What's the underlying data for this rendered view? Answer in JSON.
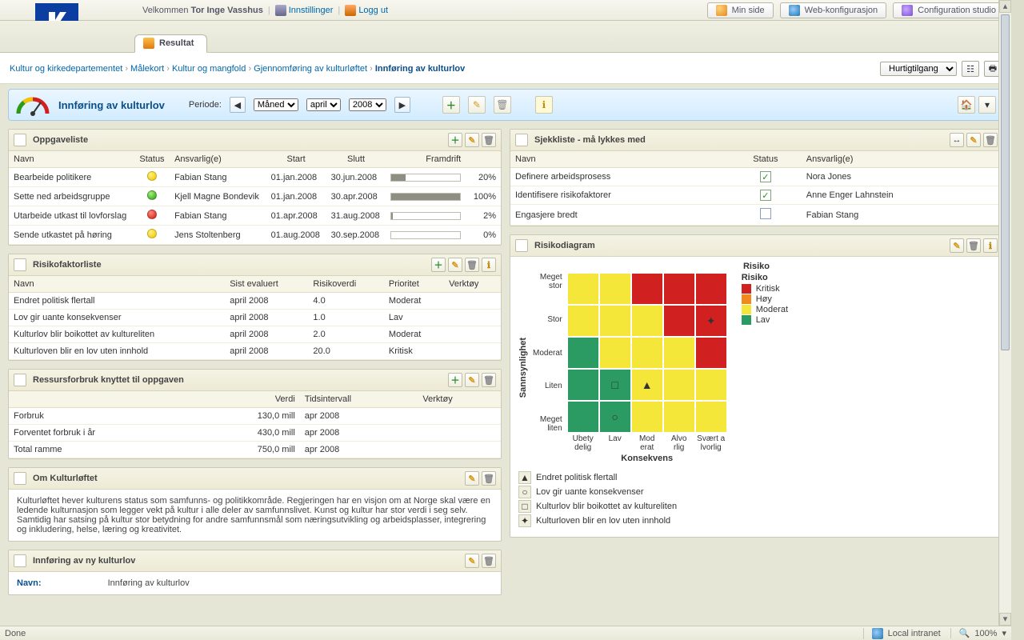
{
  "header": {
    "welcome_prefix": "Velkommen",
    "user_name": "Tor Inge Vasshus",
    "settings": "Innstillinger",
    "logout": "Logg ut",
    "buttons": {
      "my_page": "Min side",
      "web_config": "Web-konfigurasjon",
      "config_studio": "Configuration studio"
    }
  },
  "tab": {
    "label": "Resultat"
  },
  "breadcrumb": {
    "items": [
      "Kultur og kirkedepartementet",
      "Målekort",
      "Kultur og mangfold",
      "Gjennomføring av kulturløftet",
      "Innføring av kulturlov"
    ],
    "quick_access": "Hurtigtilgang"
  },
  "period_bar": {
    "title": "Innføring av kulturlov",
    "period_label": "Periode:",
    "granularity": "Måned",
    "month": "april",
    "year": "2008"
  },
  "tasks": {
    "title": "Oppgaveliste",
    "cols": {
      "name": "Navn",
      "status": "Status",
      "responsible": "Ansvarlig(e)",
      "start": "Start",
      "end": "Slutt",
      "progress": "Framdrift"
    },
    "rows": [
      {
        "name": "Bearbeide politikere",
        "status": "yellow",
        "responsible": "Fabian Stang",
        "start": "01.jan.2008",
        "end": "30.jun.2008",
        "pct": 20,
        "pct_label": "20%"
      },
      {
        "name": "Sette ned arbeidsgruppe",
        "status": "green",
        "responsible": "Kjell Magne Bondevik",
        "start": "01.jan.2008",
        "end": "30.apr.2008",
        "pct": 100,
        "pct_label": "100%"
      },
      {
        "name": "Utarbeide utkast til lovforslag",
        "status": "red",
        "responsible": "Fabian Stang",
        "start": "01.apr.2008",
        "end": "31.aug.2008",
        "pct": 2,
        "pct_label": "2%"
      },
      {
        "name": "Sende utkastet på høring",
        "status": "yellow",
        "responsible": "Jens Stoltenberg",
        "start": "01.aug.2008",
        "end": "30.sep.2008",
        "pct": 0,
        "pct_label": "0%"
      }
    ]
  },
  "checklist": {
    "title": "Sjekkliste - må lykkes med",
    "cols": {
      "name": "Navn",
      "status": "Status",
      "responsible": "Ansvarlig(e)"
    },
    "rows": [
      {
        "name": "Definere arbeidsprosess",
        "checked": true,
        "responsible": "Nora Jones"
      },
      {
        "name": "Identifisere risikofaktorer",
        "checked": true,
        "responsible": "Anne Enger Lahnstein"
      },
      {
        "name": "Engasjere bredt",
        "checked": false,
        "responsible": "Fabian Stang"
      }
    ]
  },
  "risks": {
    "title": "Risikofaktorliste",
    "cols": {
      "name": "Navn",
      "evaluated": "Sist evaluert",
      "value": "Risikoverdi",
      "priority": "Prioritet",
      "tools": "Verktøy"
    },
    "rows": [
      {
        "name": "Endret politisk flertall",
        "evaluated": "april 2008",
        "value": "4.0",
        "priority": "Moderat"
      },
      {
        "name": "Lov gir uante konsekvenser",
        "evaluated": "april 2008",
        "value": "1.0",
        "priority": "Lav"
      },
      {
        "name": "Kulturlov blir boikottet av kultureliten",
        "evaluated": "april 2008",
        "value": "2.0",
        "priority": "Moderat"
      },
      {
        "name": "Kulturloven blir en lov uten innhold",
        "evaluated": "april 2008",
        "value": "20.0",
        "priority": "Kritisk"
      }
    ]
  },
  "resources": {
    "title": "Ressursforbruk knyttet til oppgaven",
    "cols": {
      "value": "Verdi",
      "interval": "Tidsintervall",
      "tools": "Verktøy"
    },
    "rows": [
      {
        "name": "Forbruk",
        "value": "130,0 mill",
        "interval": "apr 2008"
      },
      {
        "name": "Forventet forbruk i år",
        "value": "430,0 mill",
        "interval": "apr 2008"
      },
      {
        "name": "Total ramme",
        "value": "750,0 mill",
        "interval": "apr 2008"
      }
    ]
  },
  "about": {
    "title": "Om Kulturløftet",
    "text": "Kulturløftet hever kulturens status som samfunns- og politikkområde. Regjeringen har en visjon om at Norge skal være en ledende kulturnasjon som legger vekt på kultur i alle deler av samfunnslivet. Kunst og kultur har stor verdi i seg selv. Samtidig har satsing på kultur stor betydning for andre samfunnsmål som næringsutvikling og arbeidsplasser, integrering og inkludering, helse, læring og kreativitet."
  },
  "details": {
    "title": "Innføring av ny kulturlov",
    "name_label": "Navn:",
    "name_value": "Innføring av kulturlov"
  },
  "risk_diagram": {
    "title_panel": "Risikodiagram",
    "title": "Risiko",
    "y_label": "Sannsynlighet",
    "x_label": "Konsekvens",
    "y_ticks": [
      "Meget stor",
      "Stor",
      "Moderat",
      "Liten",
      "Meget liten"
    ],
    "x_ticks": [
      "Ubety\ndelig",
      "Lav",
      "Mod\nerat",
      "Alvo\nrlig",
      "Svært a\nlvorlig"
    ],
    "legend_title": "Risiko",
    "legend": [
      {
        "label": "Kritisk",
        "color": "#d02020"
      },
      {
        "label": "Høy",
        "color": "#f08a1c"
      },
      {
        "label": "Moderat",
        "color": "#f5e63a"
      },
      {
        "label": "Lav",
        "color": "#2b9a63"
      }
    ],
    "items": [
      {
        "symbol": "▲",
        "label": "Endret politisk flertall"
      },
      {
        "symbol": "○",
        "label": "Lov gir uante konsekvenser"
      },
      {
        "symbol": "□",
        "label": "Kulturlov blir boikottet av kultureliten"
      },
      {
        "symbol": "✦",
        "label": "Kulturloven blir en lov uten innhold"
      }
    ]
  },
  "chart_data": {
    "type": "heatmap",
    "title": "Risiko",
    "xlabel": "Konsekvens",
    "ylabel": "Sannsynlighet",
    "x_categories": [
      "Ubetydelig",
      "Lav",
      "Moderat",
      "Alvorlig",
      "Svært alvorlig"
    ],
    "y_categories": [
      "Meget liten",
      "Liten",
      "Moderat",
      "Stor",
      "Meget stor"
    ],
    "grid_levels": [
      [
        "Lav",
        "Lav",
        "Moderat",
        "Moderat",
        "Moderat"
      ],
      [
        "Lav",
        "Lav",
        "Moderat",
        "Moderat",
        "Moderat"
      ],
      [
        "Lav",
        "Moderat",
        "Moderat",
        "Moderat",
        "Kritisk"
      ],
      [
        "Moderat",
        "Moderat",
        "Moderat",
        "Kritisk",
        "Kritisk"
      ],
      [
        "Moderat",
        "Moderat",
        "Kritisk",
        "Kritisk",
        "Kritisk"
      ]
    ],
    "level_colors": {
      "Lav": "#2b9a63",
      "Moderat": "#f5e63a",
      "Høy": "#f08a1c",
      "Kritisk": "#d02020"
    },
    "points": [
      {
        "name": "Endret politisk flertall",
        "symbol": "▲",
        "x_index": 2,
        "y_index": 1,
        "x": "Moderat",
        "y": "Liten"
      },
      {
        "name": "Lov gir uante konsekvenser",
        "symbol": "○",
        "x_index": 1,
        "y_index": 0,
        "x": "Lav",
        "y": "Meget liten"
      },
      {
        "name": "Kulturlov blir boikottet av kultureliten",
        "symbol": "□",
        "x_index": 1,
        "y_index": 1,
        "x": "Lav",
        "y": "Liten"
      },
      {
        "name": "Kulturloven blir en lov uten innhold",
        "symbol": "✦",
        "x_index": 4,
        "y_index": 3,
        "x": "Svært alvorlig",
        "y": "Stor"
      }
    ]
  },
  "statusbar": {
    "left": "Done",
    "zone": "Local intranet",
    "zoom": "100%"
  }
}
